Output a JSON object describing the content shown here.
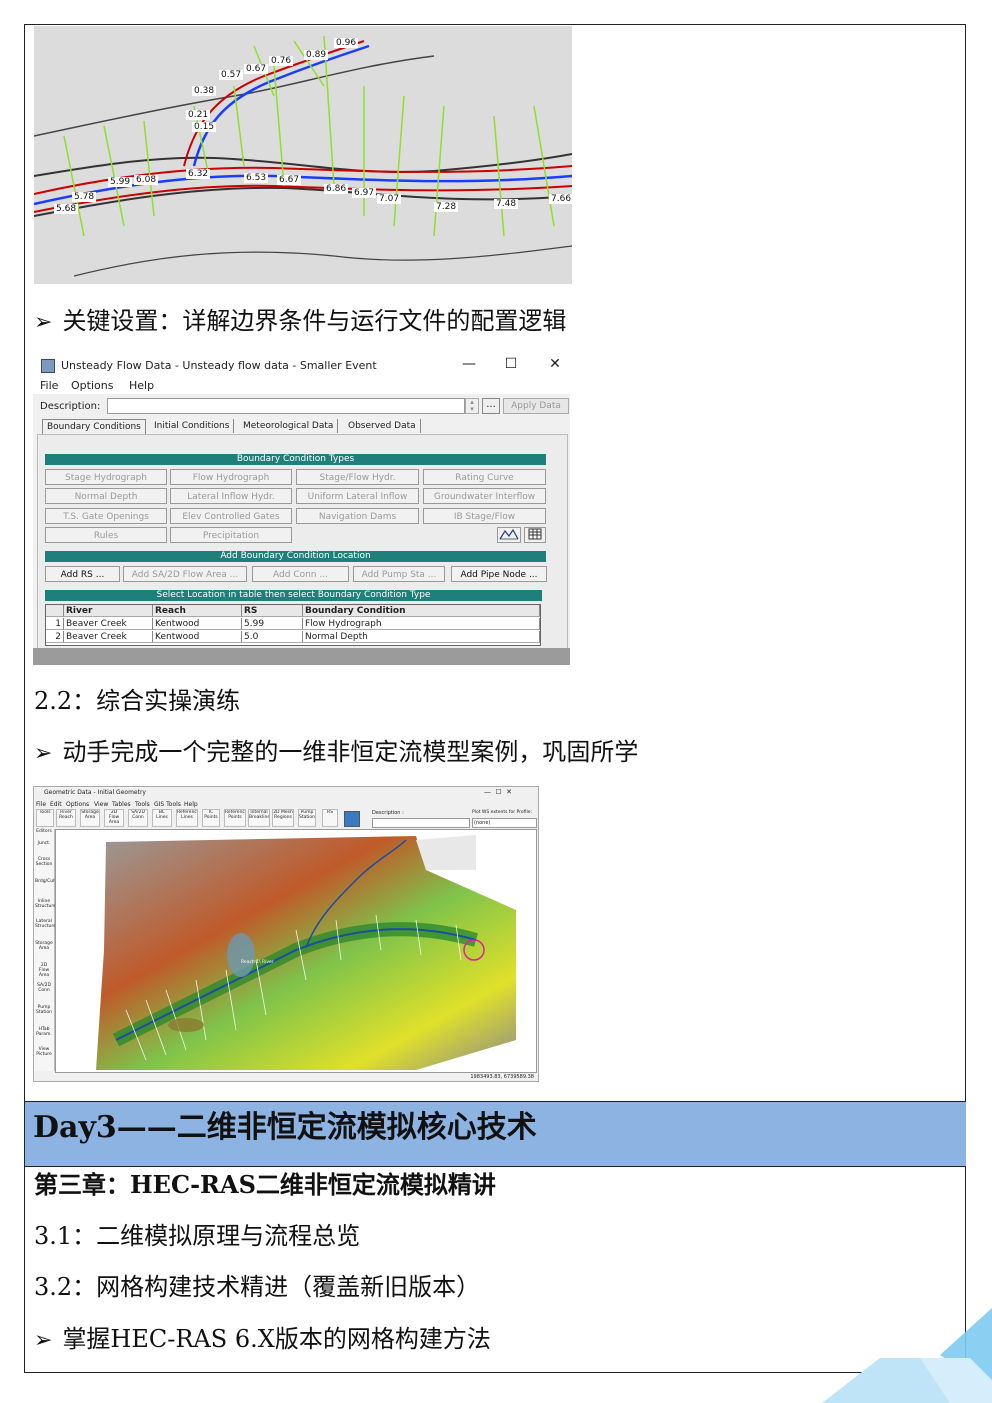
{
  "map1": {
    "labels": [
      "0.96",
      "0.89",
      "0.76",
      "0.67",
      "0.57",
      "0.38",
      "0.21",
      "0.15",
      "6.32",
      "6.53",
      "6.67",
      "6.08",
      "5.99",
      "5.78",
      "5.68",
      "6.86",
      "6.97",
      "7.07",
      "7.28",
      "7.48",
      "7.66"
    ]
  },
  "bullet1": "关键设置：详解边界条件与运行文件的配置逻辑",
  "dialog": {
    "title": "Unsteady Flow Data - Unsteady flow data - Smaller Event",
    "win_min": "—",
    "win_max": "☐",
    "win_close": "✕",
    "menu": [
      "File",
      "Options",
      "Help"
    ],
    "description_label": "Description:",
    "dots": "...",
    "apply": "Apply Data",
    "tabs": [
      "Boundary Conditions",
      "Initial Conditions",
      "Meteorological Data",
      "Observed Data"
    ],
    "bc_types_header": "Boundary Condition Types",
    "bc_types": [
      [
        "Stage Hydrograph",
        "Flow Hydrograph",
        "Stage/Flow Hydr.",
        "Rating Curve"
      ],
      [
        "Normal Depth",
        "Lateral Inflow Hydr.",
        "Uniform Lateral Inflow",
        "Groundwater Interflow"
      ],
      [
        "T.S. Gate Openings",
        "Elev Controlled Gates",
        "Navigation Dams",
        "IB Stage/Flow"
      ],
      [
        "Rules",
        "Precipitation"
      ]
    ],
    "add_loc_header": "Add Boundary Condition Location",
    "add_buttons": [
      "Add RS ...",
      "Add SA/2D Flow Area ...",
      "Add Conn ...",
      "Add Pump Sta ...",
      "Add Pipe Node ..."
    ],
    "select_header": "Select Location in table then select Boundary Condition Type",
    "table": {
      "headers": [
        "River",
        "Reach",
        "RS",
        "Boundary Condition"
      ],
      "rows": [
        {
          "n": "1",
          "river": "Beaver Creek",
          "reach": "Kentwood",
          "rs": "5.99",
          "bc": "Flow Hydrograph"
        },
        {
          "n": "2",
          "river": "Beaver Creek",
          "reach": "Kentwood",
          "rs": "5.0",
          "bc": "Normal Depth"
        }
      ]
    }
  },
  "section22": "2.2：综合实操演练",
  "bullet2": "动手完成一个完整的一维非恒定流模型案例，巩固所学",
  "geo": {
    "title": "Geometric Data - Initial Geometry",
    "menu": [
      "File",
      "Edit",
      "Options",
      "View",
      "Tables",
      "Tools",
      "GIS Tools",
      "Help"
    ],
    "tools": [
      "Tools",
      "River Reach",
      "Storage Area",
      "2D Flow Area",
      "SA/2D Conn",
      "BC Lines",
      "Reference Lines",
      "IC Points",
      "Reference Points",
      "Internal Breaklines",
      "2D Mesh Regions",
      "Pump Station",
      "RS"
    ],
    "description_label": "Description :",
    "plot_ws_label": "Plot WS extents for Profile:",
    "plot_ws_value": "(none)",
    "editors": [
      "Editors",
      "Junct.",
      "Cross Section",
      "Brdg/Culv",
      "Inline Structure",
      "Lateral Structure",
      "Storage Area",
      "2D Flow Area",
      "SA/2D Conn",
      "Pump Station",
      "HTab Param.",
      "View Picture"
    ],
    "reach_label": "Reach 1\\ River",
    "coords": "1983493.83, 6739589.38"
  },
  "day3": "Day3——二维非恒定流模拟核心技术",
  "chapter3": "第三章：HEC-RAS二维非恒定流模拟精讲",
  "s31": "3.1：二维模拟原理与流程总览",
  "s32": "3.2：网格构建技术精进（覆盖新旧版本）",
  "bullet3": "掌握HEC-RAS 6.X版本的网格构建方法",
  "bullet_glyph": "➢",
  "colors": {
    "section_bg": "#8db3e2",
    "header_teal": "#1f7f7a",
    "deco_blue": "#7ecbf2"
  }
}
